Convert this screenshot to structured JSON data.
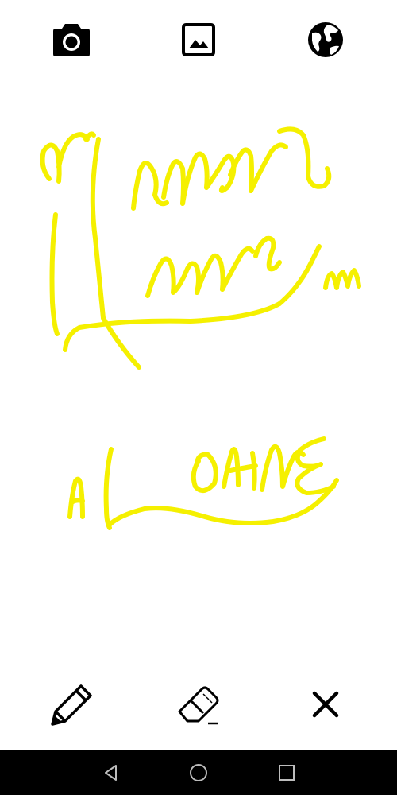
{
  "colors": {
    "ink": "#f5f000",
    "icon": "#000000",
    "nav_bg": "#000000",
    "nav_icon": "#bdbdbd",
    "background": "#ffffff"
  },
  "top_toolbar": {
    "icons": [
      "camera-icon",
      "image-gallery-icon",
      "globe-icon"
    ]
  },
  "bottom_toolbar": {
    "icons": [
      "pencil-icon",
      "eraser-icon",
      "close-icon"
    ]
  },
  "navigation_bar": {
    "icons": [
      "back-triangle-icon",
      "home-circle-icon",
      "recents-square-icon"
    ]
  }
}
